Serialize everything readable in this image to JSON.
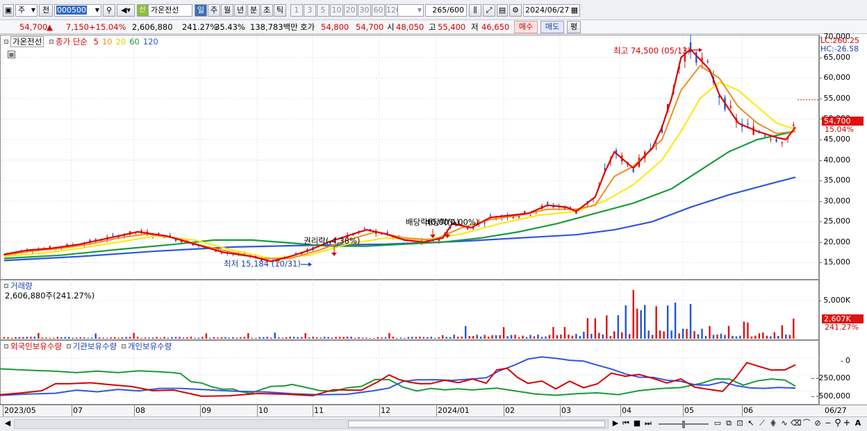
{
  "toolbar": {
    "period_type": "주",
    "prev_label": "전",
    "code": "000500",
    "stock_name": "가온전선",
    "badge_shin": "신",
    "period_tabs": [
      "일",
      "주",
      "월",
      "년",
      "분",
      "초",
      "틱"
    ],
    "active_tab": "일",
    "numbers": [
      "1",
      "3",
      "5",
      "10",
      "20",
      "30",
      "60",
      "120"
    ],
    "count": "265",
    "max_count": "/600",
    "date": "2024/06/27"
  },
  "quote": {
    "price": "54,700",
    "arrow": "▲",
    "change": "7,150",
    "change_pct": "+15.04%",
    "volume": "2,606,880",
    "volume_ratio": "241.27%",
    "turnover": "35.43%",
    "amount": "138,783백만",
    "ask_label": "호가",
    "ask": "54,800",
    "bid": "54,700",
    "open_label": "시",
    "open": "48,050",
    "high_label": "고",
    "high": "55,400",
    "low_label": "저",
    "low": "46,650",
    "buy_button": "매수",
    "sell_button": "매도",
    "eval_button": "평"
  },
  "price_panel": {
    "name": "가온전선",
    "ma_label": "종가 단순",
    "ma_periods": [
      "5",
      "10",
      "20",
      "60",
      "120"
    ],
    "ma_colors": [
      "#e00000",
      "#f28c1c",
      "#ffe600",
      "#1a9a3a",
      "#2d57e0"
    ],
    "lc_label": "LC:260.25",
    "hc_label": "HC:-26.58",
    "max_annotation": "최고 74,500 (05/13)",
    "min_annotation": "최저 15,184 (10/31)",
    "rights_annotation": "권리락(-4.38%)",
    "dividend_annotation_1": "배당락(0.00%)",
    "dividend_annotation_2": "배당락(0.00%)",
    "last_price_flag": "54,700",
    "last_change_flag": "15.04%",
    "y_ticks": [
      "70,000",
      "65,000",
      "60,000",
      "55,000",
      "50,000",
      "45,000",
      "40,000",
      "35,000",
      "30,000",
      "25,000",
      "20,000",
      "15,000"
    ]
  },
  "volume_panel": {
    "title": "거래량",
    "value": "2,606,880주(241.27%)",
    "y_tick": "5,000K",
    "flag_value": "2,607K",
    "flag_pct": "241.27%"
  },
  "holdings_panel": {
    "legends": [
      "외국인보유수량",
      "기관보유수량",
      "개인보유수량"
    ],
    "legend_colors": [
      "#d40000",
      "#2d57e0",
      "#1a9a3a"
    ],
    "y_ticks": [
      "0",
      "-250,000",
      "-500,000"
    ]
  },
  "x_axis": [
    "2023/05",
    "07",
    "08",
    "09",
    "10",
    "11",
    "12",
    "2024/01",
    "02",
    "03",
    "04",
    "05",
    "06",
    "06/27"
  ],
  "chart_data": {
    "type": "line",
    "title": "가온전선",
    "ylim": [
      11000,
      78000
    ],
    "x_range": [
      "2023/05",
      "2024/06/27"
    ],
    "series": [
      {
        "name": "종가 단순 5",
        "points": [
          [
            0,
            17000
          ],
          [
            12,
            18000
          ],
          [
            25,
            18500
          ],
          [
            40,
            19500
          ],
          [
            55,
            21000
          ],
          [
            70,
            22500
          ],
          [
            85,
            21500
          ],
          [
            100,
            19500
          ],
          [
            115,
            17500
          ],
          [
            130,
            16500
          ],
          [
            140,
            15300
          ],
          [
            150,
            16500
          ],
          [
            160,
            18000
          ],
          [
            170,
            20000
          ],
          [
            180,
            21500
          ],
          [
            190,
            23000
          ],
          [
            200,
            22000
          ],
          [
            210,
            20500
          ],
          [
            220,
            20000
          ],
          [
            230,
            21000
          ],
          [
            235,
            24500
          ],
          [
            245,
            23500
          ],
          [
            255,
            26000
          ],
          [
            265,
            26500
          ],
          [
            275,
            27000
          ],
          [
            285,
            29000
          ],
          [
            295,
            28500
          ],
          [
            300,
            27500
          ],
          [
            310,
            31000
          ],
          [
            315,
            37000
          ],
          [
            320,
            42000
          ],
          [
            330,
            38000
          ],
          [
            340,
            43000
          ],
          [
            345,
            48000
          ],
          [
            350,
            55000
          ],
          [
            355,
            65000
          ],
          [
            360,
            67000
          ],
          [
            370,
            62000
          ],
          [
            375,
            56000
          ],
          [
            385,
            49000
          ],
          [
            395,
            47000
          ],
          [
            405,
            45500
          ],
          [
            410,
            45000
          ],
          [
            415,
            48000
          ]
        ]
      },
      {
        "name": "종가 단순 10",
        "points": [
          [
            0,
            16800
          ],
          [
            15,
            17800
          ],
          [
            30,
            18500
          ],
          [
            45,
            19500
          ],
          [
            60,
            21000
          ],
          [
            75,
            22000
          ],
          [
            90,
            21000
          ],
          [
            105,
            19000
          ],
          [
            120,
            17500
          ],
          [
            135,
            16000
          ],
          [
            150,
            16000
          ],
          [
            165,
            18000
          ],
          [
            180,
            20500
          ],
          [
            195,
            22500
          ],
          [
            210,
            21000
          ],
          [
            225,
            20500
          ],
          [
            240,
            23500
          ],
          [
            255,
            25500
          ],
          [
            270,
            26500
          ],
          [
            285,
            28000
          ],
          [
            300,
            28000
          ],
          [
            310,
            29000
          ],
          [
            320,
            36000
          ],
          [
            330,
            38500
          ],
          [
            345,
            45000
          ],
          [
            355,
            57000
          ],
          [
            365,
            63000
          ],
          [
            375,
            60000
          ],
          [
            385,
            53000
          ],
          [
            395,
            49000
          ],
          [
            405,
            46500
          ],
          [
            415,
            47000
          ]
        ]
      },
      {
        "name": "종가 단순 20",
        "points": [
          [
            0,
            16500
          ],
          [
            20,
            17300
          ],
          [
            40,
            18500
          ],
          [
            60,
            20000
          ],
          [
            80,
            21500
          ],
          [
            100,
            20500
          ],
          [
            120,
            18000
          ],
          [
            140,
            16000
          ],
          [
            160,
            16800
          ],
          [
            180,
            19500
          ],
          [
            200,
            21000
          ],
          [
            220,
            20500
          ],
          [
            240,
            22000
          ],
          [
            260,
            24500
          ],
          [
            280,
            26500
          ],
          [
            300,
            27500
          ],
          [
            315,
            30000
          ],
          [
            330,
            34000
          ],
          [
            345,
            40000
          ],
          [
            355,
            47000
          ],
          [
            365,
            55000
          ],
          [
            375,
            59000
          ],
          [
            385,
            57000
          ],
          [
            395,
            53000
          ],
          [
            405,
            49000
          ],
          [
            415,
            47500
          ]
        ]
      },
      {
        "name": "종가 단순 60",
        "points": [
          [
            0,
            16000
          ],
          [
            30,
            16800
          ],
          [
            60,
            18200
          ],
          [
            90,
            19500
          ],
          [
            110,
            20500
          ],
          [
            130,
            20500
          ],
          [
            150,
            19800
          ],
          [
            170,
            19000
          ],
          [
            190,
            19000
          ],
          [
            210,
            19500
          ],
          [
            230,
            20000
          ],
          [
            250,
            21000
          ],
          [
            270,
            22500
          ],
          [
            290,
            24500
          ],
          [
            310,
            27000
          ],
          [
            330,
            29500
          ],
          [
            350,
            33000
          ],
          [
            365,
            37500
          ],
          [
            380,
            42000
          ],
          [
            395,
            45000
          ],
          [
            405,
            46000
          ],
          [
            415,
            47000
          ]
        ]
      },
      {
        "name": "종가 단순 120",
        "points": [
          [
            0,
            15500
          ],
          [
            40,
            16500
          ],
          [
            80,
            17800
          ],
          [
            120,
            18800
          ],
          [
            160,
            19200
          ],
          [
            200,
            19500
          ],
          [
            240,
            20200
          ],
          [
            270,
            21000
          ],
          [
            300,
            21800
          ],
          [
            320,
            23000
          ],
          [
            340,
            25000
          ],
          [
            360,
            28500
          ],
          [
            380,
            31500
          ],
          [
            400,
            34000
          ],
          [
            415,
            35800
          ]
        ]
      }
    ]
  }
}
